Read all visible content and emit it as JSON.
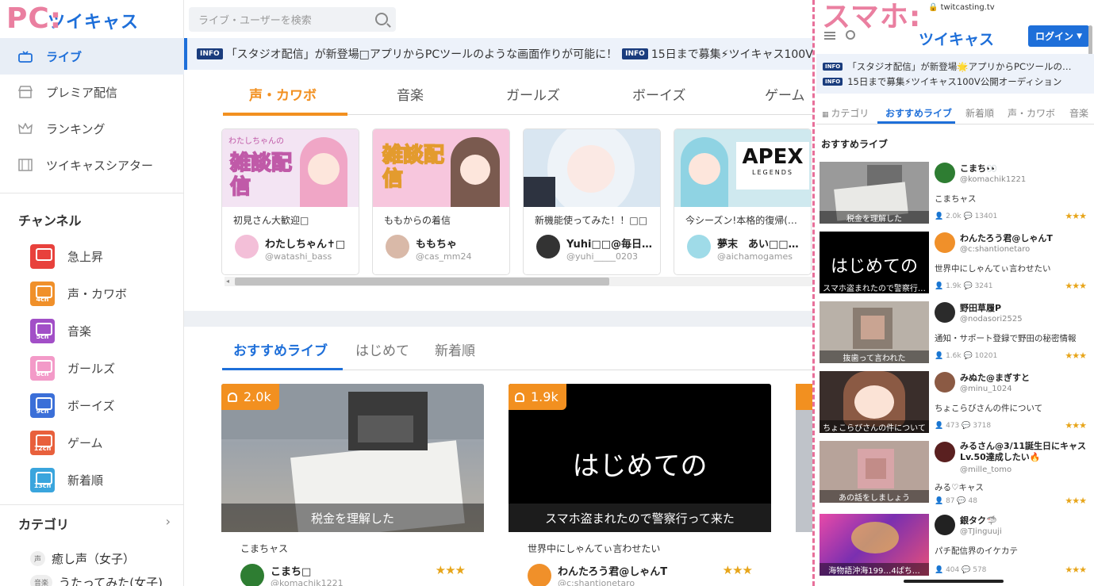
{
  "annotations": {
    "pc_label": "PC:",
    "sp_label": "スマホ:"
  },
  "pc": {
    "logo": "ツイキャス",
    "search": {
      "placeholder": "ライブ・ユーザーを検索"
    },
    "nav": [
      {
        "label": "ライブ",
        "icon": "live-tv-icon",
        "active": true
      },
      {
        "label": "プレミア配信",
        "icon": "premier-store-icon",
        "active": false
      },
      {
        "label": "ランキング",
        "icon": "crown-icon",
        "active": false
      },
      {
        "label": "ツイキャスシアター",
        "icon": "film-icon",
        "active": false
      }
    ],
    "channels_heading": "チャンネル",
    "channels": [
      {
        "label": "急上昇",
        "badge": "",
        "color": "#e8413c",
        "icon": "flame-icon"
      },
      {
        "label": "声・カワボ",
        "badge": "4ch",
        "color": "#f0902a",
        "icon": "channel-4ch-icon"
      },
      {
        "label": "音楽",
        "badge": "5ch",
        "color": "#a24fc7",
        "icon": "channel-5ch-icon"
      },
      {
        "label": "ガールズ",
        "badge": "8ch",
        "color": "#f39ac8",
        "icon": "channel-8ch-icon"
      },
      {
        "label": "ボーイズ",
        "badge": "9ch",
        "color": "#3b6fd8",
        "icon": "channel-9ch-icon"
      },
      {
        "label": "ゲーム",
        "badge": "12ch",
        "color": "#e8603c",
        "icon": "channel-12ch-icon"
      },
      {
        "label": "新着順",
        "badge": "13ch",
        "color": "#3aa5dd",
        "icon": "channel-13ch-icon"
      }
    ],
    "categories_heading": "カテゴリ",
    "categories": [
      {
        "tag": "声",
        "label": "癒し声（女子）"
      },
      {
        "tag": "音楽",
        "label": "うたってみた(女子)"
      }
    ],
    "info": [
      {
        "tag": "INFO",
        "text": "「スタジオ配信」が新登場□アプリからPCツールのような画面作りが可能に！"
      },
      {
        "tag": "INFO",
        "text": "15日まで募集⚡ツイキャス100V公開"
      }
    ],
    "genre_tabs": [
      "声・カワボ",
      "音楽",
      "ガールズ",
      "ボーイズ",
      "ゲーム"
    ],
    "genre_cards": [
      {
        "thumb_text": "雑談配信",
        "thumb_sub": "わたしちゃんの",
        "title": "初見さん大歓迎□",
        "name": "わたしちゃん✝□",
        "id": "@watashi_bass",
        "bg": "#f3e4f3",
        "accent": "#c05aa8"
      },
      {
        "thumb_text": "雑談配信",
        "thumb_sub": "",
        "title": "ももからの着信",
        "name": "ももちゃ",
        "id": "@cas_mm24",
        "bg": "#f7c6dd",
        "accent": "#f0a93b"
      },
      {
        "thumb_text": "",
        "thumb_sub": "",
        "title": "新機能使ってみた！！□□",
        "name": "Yuhi□□@毎日…",
        "id": "@yuhi_____0203",
        "bg": "#d9e6f1",
        "accent": "#b9c7d8"
      },
      {
        "thumb_text": "APEX",
        "thumb_sub": "LEGENDS",
        "title": "今シーズン!本格的復帰(…",
        "name": "夢末　あい□□…",
        "id": "@aichamogames",
        "bg": "#cfe9ef",
        "accent": "#111111"
      }
    ],
    "rec_tabs": [
      "おすすめライブ",
      "はじめて",
      "新着順"
    ],
    "rec_cards": [
      {
        "viewers": "2.0k",
        "caption": "税金を理解した",
        "desc": "こまちャス",
        "name": "こまち□",
        "id": "@komachik1221",
        "stars": "★★★",
        "dark": false
      },
      {
        "viewers": "1.9k",
        "caption": "スマホ盗まれたので警察行って来た",
        "big_text": "はじめての",
        "desc": "世界中にしゃんてぃ言わせたい",
        "name": "わんたろう君@しゃんT",
        "id": "@c:shantionetaro",
        "stars": "★★★",
        "dark": true
      }
    ]
  },
  "sp": {
    "url": "twitcasting.tv",
    "logo": "ツイキャス",
    "login": "ログイン",
    "info": [
      {
        "tag": "INFO",
        "text": "「スタジオ配信」が新登場🌟アプリからPCツールの…"
      },
      {
        "tag": "INFO",
        "text": "15日まで募集⚡ツイキャス100V公開オーディション"
      }
    ],
    "tabs": [
      "カテゴリ",
      "おすすめライブ",
      "新着順",
      "声・カワボ",
      "音楽"
    ],
    "section_heading": "おすすめライブ",
    "rows": [
      {
        "caption": "税金を理解した",
        "big_text": "",
        "name": "こまち👀",
        "id": "@komachik1221",
        "desc": "こまちャス",
        "viewers": "2.0k",
        "comments": "13401",
        "stars": "★★★",
        "bg": "#9a9a9a"
      },
      {
        "caption": "スマホ盗まれたので警察行…",
        "big_text": "はじめての",
        "name": "わんたろう君@しゃんT",
        "id": "@c:shantionetaro",
        "desc": "世界中にしゃんてぃ言わせたい",
        "viewers": "1.9k",
        "comments": "3241",
        "stars": "★★★",
        "bg": "#000000"
      },
      {
        "caption": "抜歯って言われた",
        "big_text": "",
        "name": "野田草履P",
        "id": "@nodasori2525",
        "desc": "通知・サポート登録で野田の秘密情報",
        "viewers": "1.6k",
        "comments": "10201",
        "stars": "★★★",
        "bg": "#b9b1a8"
      },
      {
        "caption": "ちょこらびさんの件について",
        "big_text": "",
        "name": "みぬた@まぎすと",
        "id": "@minu_1024",
        "desc": "ちょこらびさんの件について",
        "viewers": "473",
        "comments": "3718",
        "stars": "★★★",
        "bg": "#5a4640"
      },
      {
        "caption": "あの話をしましょう",
        "big_text": "",
        "name": "みるさん@3/11誕生日にキャスLv.50達成したい🔥",
        "id": "@mille_tomo",
        "desc": "みる♡キャス",
        "viewers": "87",
        "comments": "48",
        "stars": "★★★",
        "bg": "#b7a39a"
      },
      {
        "caption": "海物語沖海199…4ぱち…",
        "big_text": "",
        "name": "銀タク🦈",
        "id": "@TJinguuji",
        "desc": "パチ配信界のイケカテ",
        "viewers": "404",
        "comments": "578",
        "stars": "★★★",
        "bg": "#c53a8c"
      }
    ]
  }
}
